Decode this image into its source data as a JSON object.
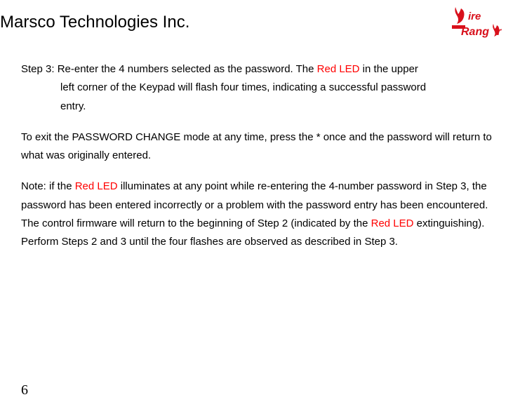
{
  "header": {
    "company": "Marsco Technologies Inc.",
    "logo": {
      "name": "fire-ranger-logo",
      "text_top": "ire",
      "text_bottom": "Ranger",
      "color": "#d8101b"
    }
  },
  "content": {
    "step3": {
      "label": "Step 3: ",
      "line1": "Re-enter the 4 numbers selected as the password. The ",
      "red1": "Red LED",
      "line1b": " in the upper",
      "line2": "left corner of the Keypad will flash four times, indicating a successful password",
      "line3": "entry."
    },
    "exit": {
      "text": "To exit the PASSWORD CHANGE mode at any time, press the   *   once and the password will return to what was originally entered."
    },
    "note": {
      "t1": "Note: if the ",
      "red1": "Red LED",
      "t2": " illuminates at any point while re-entering the 4-number password in Step 3, the password has been entered incorrectly or a problem with the password entry has been encountered. The control firmware will return to the beginning of Step 2 (indicated by the ",
      "red2": "Red LED",
      "t3": " extinguishing).  Perform Steps 2 and 3 until the four flashes are observed as described in Step 3."
    }
  },
  "page_number": "6"
}
